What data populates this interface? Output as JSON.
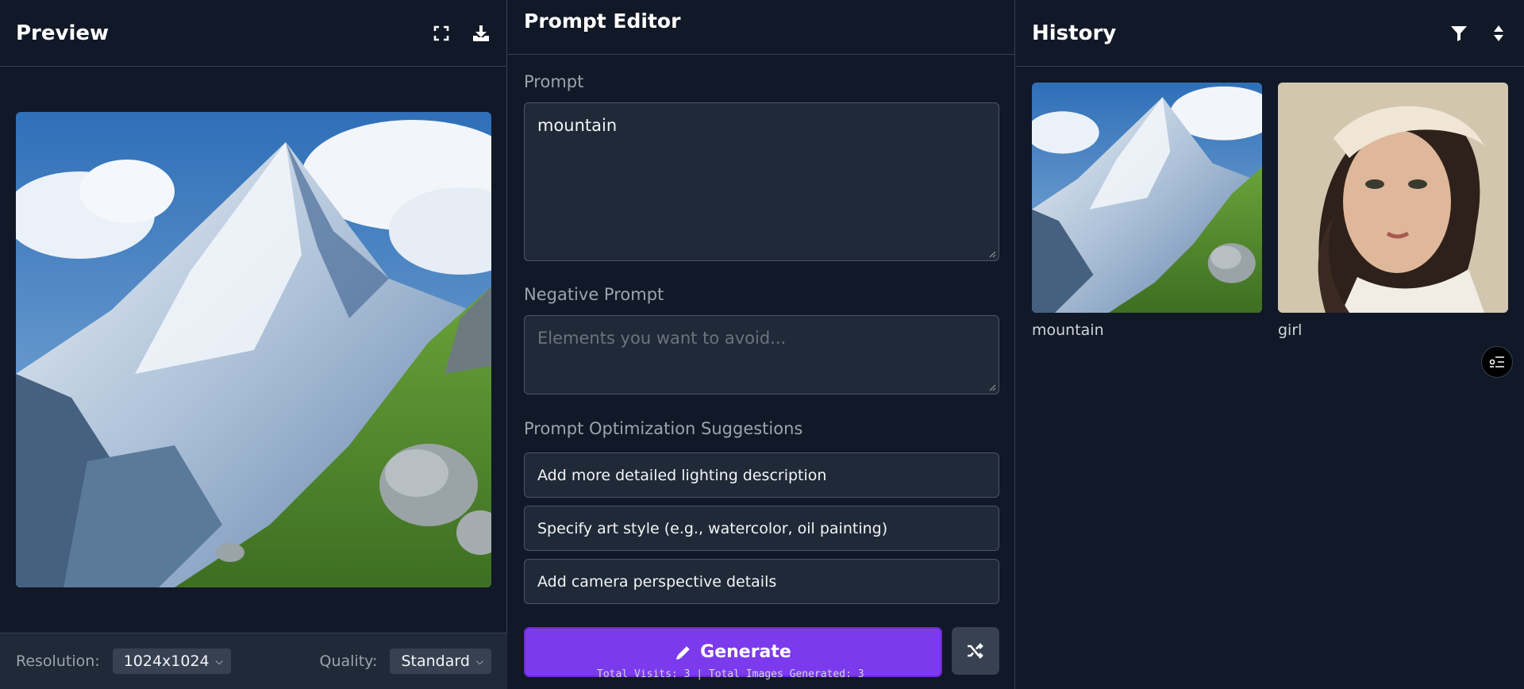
{
  "preview": {
    "title": "Preview",
    "icons": [
      "fullscreen-icon",
      "download-icon"
    ],
    "image_alt": "mountain",
    "resolution_label": "Resolution:",
    "resolution_value": "1024x1024",
    "quality_label": "Quality:",
    "quality_value": "Standard"
  },
  "editor": {
    "title": "Prompt Editor",
    "prompt_label": "Prompt",
    "prompt_value": "mountain",
    "negative_label": "Negative Prompt",
    "negative_placeholder": "Elements you want to avoid...",
    "suggestions_label": "Prompt Optimization Suggestions",
    "suggestions": [
      "Add more detailed lighting description",
      "Specify art style (e.g., watercolor, oil painting)",
      "Add camera perspective details"
    ],
    "generate_label": "Generate",
    "stats": "Total Visits: 3 | Total Images Generated: 3"
  },
  "history": {
    "title": "History",
    "icons": [
      "filter-icon",
      "sort-icon"
    ],
    "items": [
      {
        "caption": "mountain"
      },
      {
        "caption": "girl"
      }
    ]
  },
  "colors": {
    "background": "#111827",
    "surface": "#1f2937",
    "border": "#374151",
    "accent": "#7c3aed"
  }
}
